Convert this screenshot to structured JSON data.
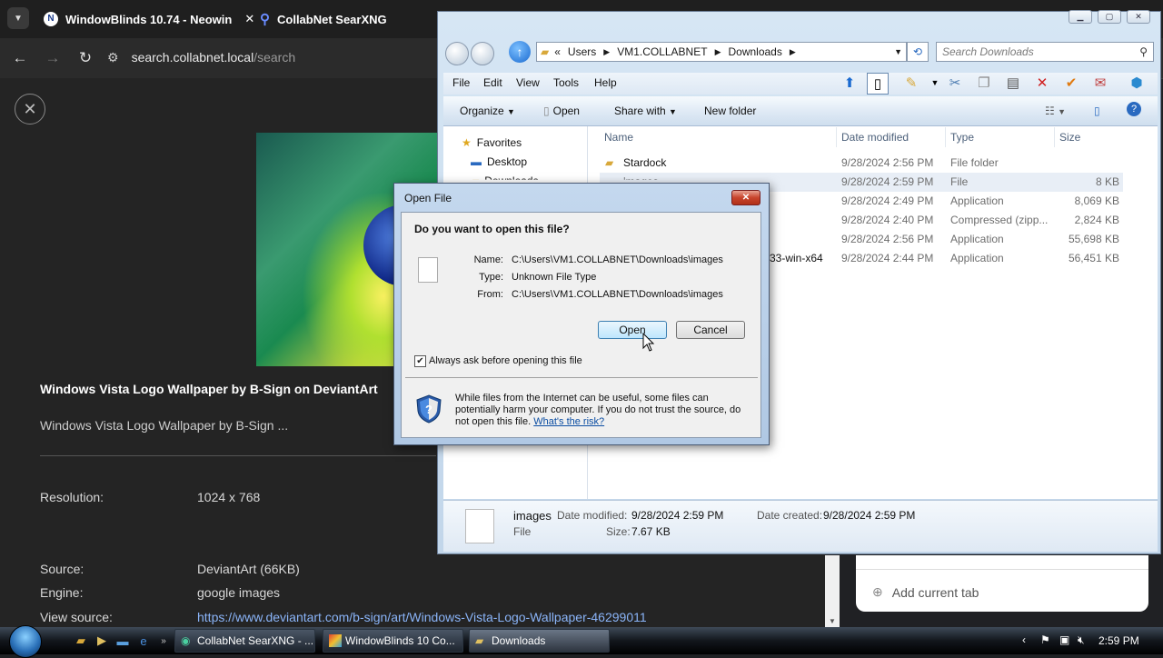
{
  "browser": {
    "tabs": [
      {
        "title": "WindowBlinds 10.74 - Neowin"
      },
      {
        "title": "CollabNet SearXNG"
      }
    ],
    "url_host": "search.collabnet.local",
    "url_path": "/search"
  },
  "result": {
    "title": "Windows Vista Logo Wallpaper by B-Sign on DeviantArt",
    "subtitle": "Windows Vista Logo Wallpaper by B-Sign ...",
    "resolution_label": "Resolution:",
    "resolution": "1024 x 768",
    "source_label": "Source:",
    "source": "DeviantArt (66KB)",
    "engine_label": "Engine:",
    "engine": "google images",
    "view_source_label": "View source:",
    "view_source": "https://www.deviantart.com/b-sign/art/Windows-Vista-Logo-Wallpaper-46299011"
  },
  "tab_panel": {
    "add_current_tab": "Add current tab"
  },
  "explorer": {
    "path": [
      "«",
      "Users",
      "VM1.COLLABNET",
      "Downloads"
    ],
    "search_placeholder": "Search Downloads",
    "menu": [
      "File",
      "Edit",
      "View",
      "Tools",
      "Help"
    ],
    "commands": {
      "organize": "Organize",
      "open": "Open",
      "share_with": "Share with",
      "new_folder": "New folder"
    },
    "columns": [
      "Name",
      "Date modified",
      "Type",
      "Size"
    ],
    "nav": {
      "favorites": "Favorites",
      "desktop": "Desktop",
      "downloads": "Downloads"
    },
    "files": [
      {
        "name": "Stardock",
        "date": "9/28/2024 2:56 PM",
        "type": "File folder",
        "size": ""
      },
      {
        "name": "images",
        "date": "9/28/2024 2:59 PM",
        "type": "File",
        "size": "8 KB"
      },
      {
        "name": "",
        "date": "9/28/2024 2:49 PM",
        "type": "Application",
        "size": "8,069 KB"
      },
      {
        "name": "",
        "date": "9/28/2024 2:40 PM",
        "type": "Compressed (zipp...",
        "size": "2,824 KB"
      },
      {
        "name": "",
        "date": "9/28/2024 2:56 PM",
        "type": "Application",
        "size": "55,698 KB"
      },
      {
        "name": "33-win-x64",
        "date": "9/28/2024 2:44 PM",
        "type": "Application",
        "size": "56,451 KB"
      }
    ],
    "details": {
      "name": "images",
      "kind": "File",
      "date_modified_label": "Date modified:",
      "date_modified": "9/28/2024 2:59 PM",
      "size_label": "Size:",
      "size": "7.67 KB",
      "date_created_label": "Date created:",
      "date_created": "9/28/2024 2:59 PM"
    }
  },
  "dialog": {
    "title": "Open File",
    "question": "Do you want to open this file?",
    "name_label": "Name:",
    "name": "C:\\Users\\VM1.COLLABNET\\Downloads\\images",
    "type_label": "Type:",
    "type": "Unknown File Type",
    "from_label": "From:",
    "from": "C:\\Users\\VM1.COLLABNET\\Downloads\\images",
    "open_button": "Open",
    "cancel_button": "Cancel",
    "checkbox_label": "Always ask before opening this file",
    "checkbox_checked": true,
    "warning": "While files from the Internet can be useful, some files can potentially harm your computer. If you do not trust the source, do not open this file.",
    "risk_link": "What's the risk?"
  },
  "taskbar": {
    "buttons": [
      "CollabNet SearXNG - ...",
      "WindowBlinds 10 Co...",
      "Downloads"
    ],
    "clock": "2:59 PM"
  }
}
